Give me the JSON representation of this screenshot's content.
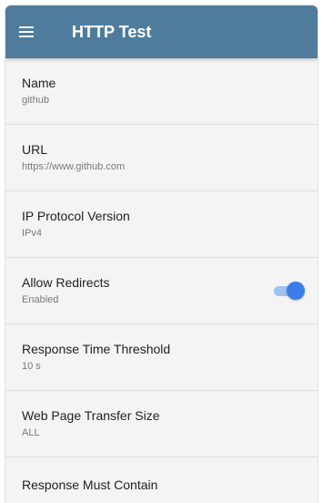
{
  "toolbar": {
    "title": "HTTP Test",
    "menu_icon": "hamburger-menu-icon",
    "color": "#4f7c9c"
  },
  "settings": [
    {
      "label": "Name",
      "value": "github"
    },
    {
      "label": "URL",
      "value": "https://www.github.com"
    },
    {
      "label": "IP Protocol Version",
      "value": "IPv4"
    },
    {
      "label": "Allow Redirects",
      "value": "Enabled",
      "toggle_on": true
    },
    {
      "label": "Response Time Threshold",
      "value": "10 s"
    },
    {
      "label": "Web Page Transfer Size",
      "value": "ALL"
    },
    {
      "label": "Response Must Contain",
      "value": ""
    }
  ],
  "colors": {
    "toggle_track": "#9ec3f7",
    "toggle_thumb": "#3b7de8",
    "background": "#f4f4f4"
  }
}
